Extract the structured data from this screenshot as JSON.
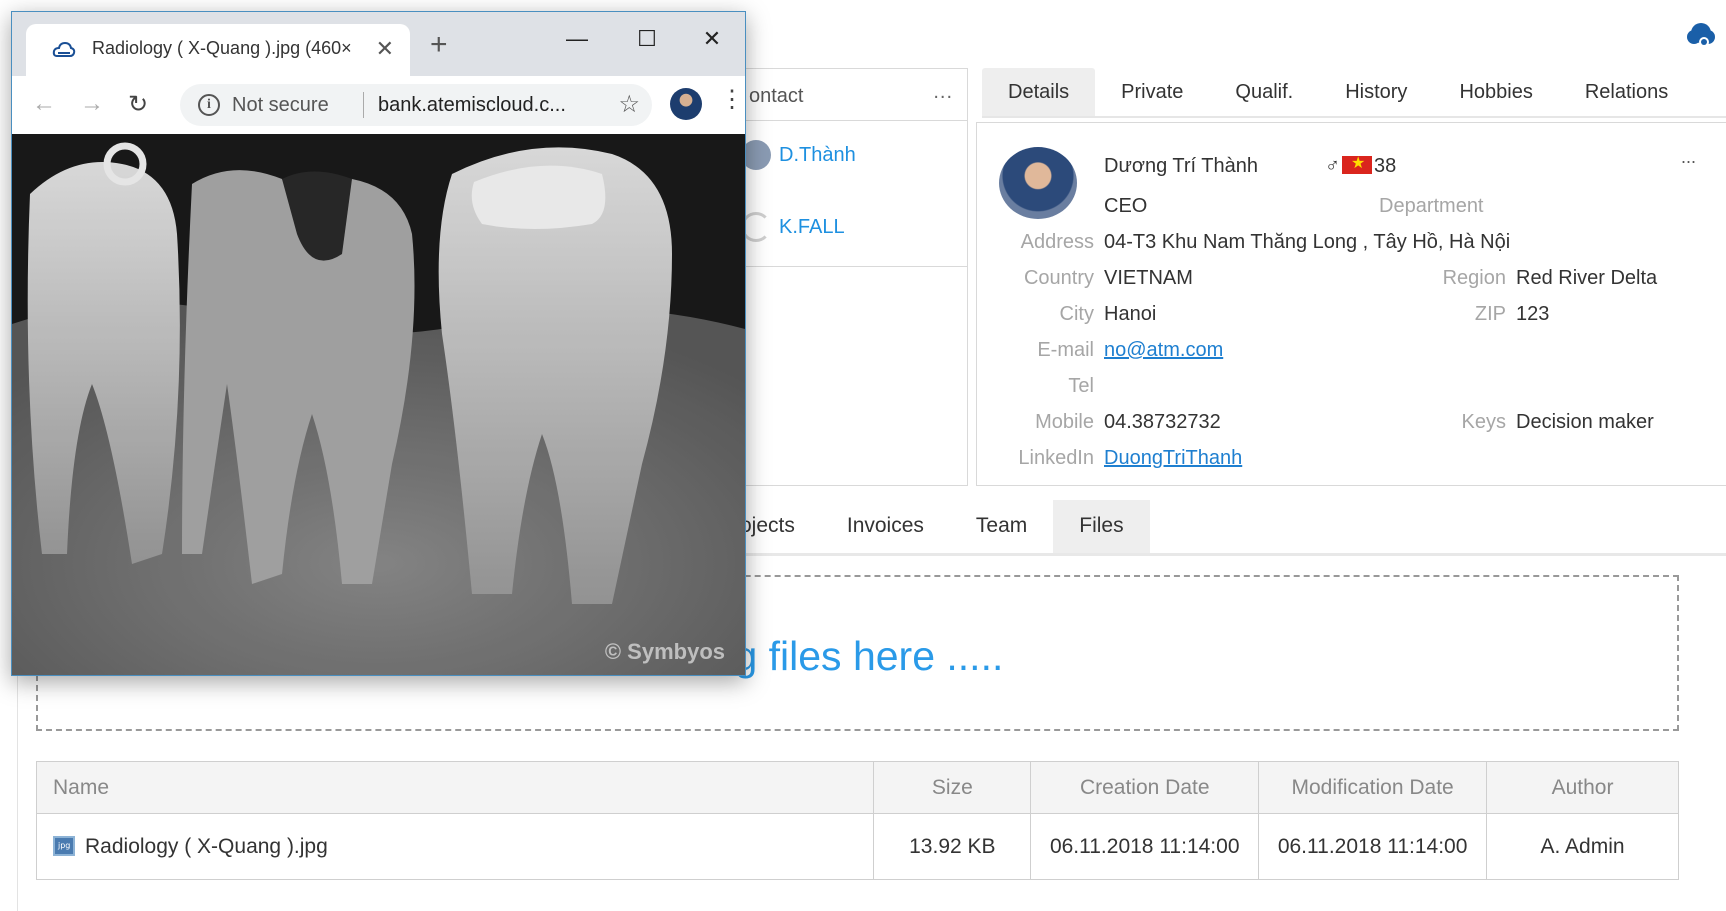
{
  "contact_panel": {
    "title": "ontact",
    "more": "...",
    "items": [
      {
        "name": "D.Thành"
      },
      {
        "name": "K.FALL"
      }
    ]
  },
  "details_tabs": [
    "Details",
    "Private",
    "Qualif.",
    "History",
    "Hobbies",
    "Relations"
  ],
  "person": {
    "name": "Dương Trí Thành",
    "gender": "♂",
    "age": "38",
    "position": "CEO",
    "department_label": "Department",
    "more": "...",
    "address_label": "Address",
    "address": "04-T3 Khu Nam Thăng Long , Tây Hồ, Hà Nội",
    "country_label": "Country",
    "country": "VIETNAM",
    "region_label": "Region",
    "region": "Red River Delta",
    "city_label": "City",
    "city": "Hanoi",
    "zip_label": "ZIP",
    "zip": "123",
    "email_label": "E-mail",
    "email": "no@atm.com",
    "tel_label": "Tel",
    "mobile_label": "Mobile",
    "mobile": "04.38732732",
    "keys_label": "Keys",
    "keys": "Decision maker",
    "linkedin_label": "LinkedIn",
    "linkedin": "DuongTriThanh"
  },
  "bottom_tabs": [
    "ojects",
    "Invoices",
    "Team",
    "Files"
  ],
  "dropzone": {
    "text": "ag files here ....."
  },
  "files_table": {
    "headers": [
      "Name",
      "Size",
      "Creation Date",
      "Modification Date",
      "Author"
    ],
    "rows": [
      {
        "name": "Radiology ( X-Quang ).jpg",
        "size": "13.92 KB",
        "created": "06.11.2018 11:14:00",
        "modified": "06.11.2018 11:14:00",
        "author": "A. Admin"
      }
    ]
  },
  "popup": {
    "tab_title": "Radiology ( X-Quang ).jpg (460×",
    "security": "Not secure",
    "url": "bank.atemiscloud.c...",
    "watermark": "© Symbyos"
  },
  "colors": {
    "accent": "#1e90e0",
    "link": "#1e7fd0",
    "tab_active": "#eeeeee"
  }
}
